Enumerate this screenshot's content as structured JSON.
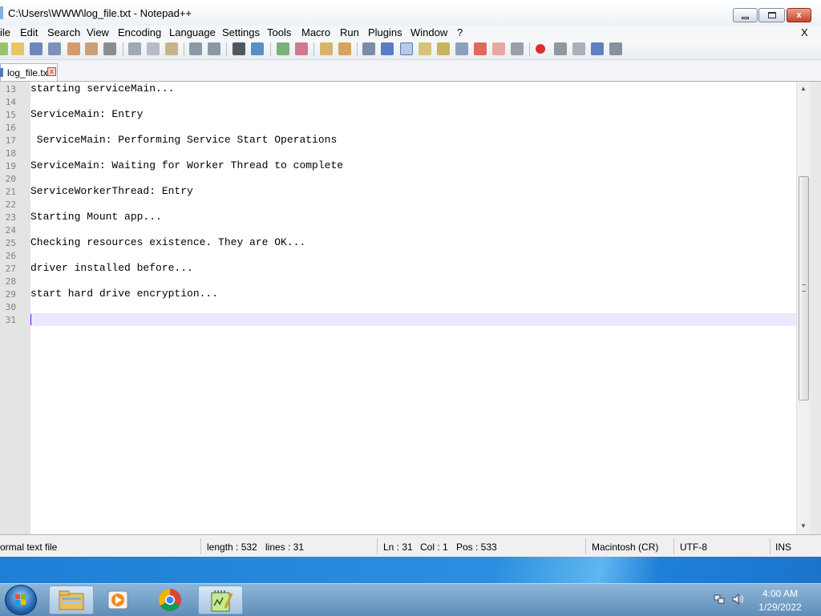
{
  "window": {
    "title": "C:\\Users\\WWW\\log_file.txt - Notepad++",
    "close_glyph": "x",
    "menu_close": "X"
  },
  "menu": {
    "items": [
      "ile",
      "Edit",
      "Search",
      "View",
      "Encoding",
      "Language",
      "Settings",
      "Tools",
      "Macro",
      "Run",
      "Plugins",
      "Window",
      "?"
    ]
  },
  "tab": {
    "label": "log_file.txt",
    "close_glyph": "x"
  },
  "editor": {
    "line_numbers": [
      "13",
      "14",
      "15",
      "16",
      "17",
      "18",
      "19",
      "20",
      "21",
      "22",
      "23",
      "24",
      "25",
      "26",
      "27",
      "28",
      "29",
      "30",
      "31"
    ],
    "lines": [
      "starting serviceMain...",
      "",
      "ServiceMain: Entry",
      "",
      " ServiceMain: Performing Service Start Operations",
      "",
      "ServiceMain: Waiting for Worker Thread to complete",
      "",
      "ServiceWorkerThread: Entry",
      "",
      "Starting Mount app...",
      "",
      "Checking resources existence. They are OK...",
      "",
      "driver installed before...",
      "",
      "start hard drive encryption...",
      "",
      ""
    ]
  },
  "statusbar": {
    "file_type": "ormal text file",
    "length": "length : 532",
    "lines": "lines : 31",
    "ln": "Ln : 31",
    "col": "Col : 1",
    "pos": "Pos : 533",
    "eol": "Macintosh (CR)",
    "encoding": "UTF-8",
    "mode": "INS"
  },
  "taskbar": {
    "clock_time": "4:00 AM",
    "clock_date": "1/29/2022"
  }
}
